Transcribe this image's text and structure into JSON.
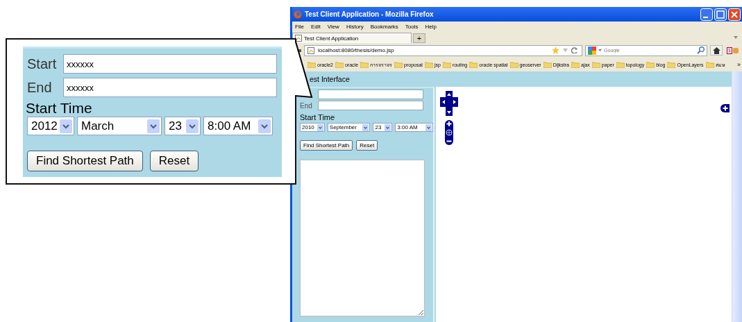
{
  "window": {
    "title": "Test Client Application - Mozilla Firefox"
  },
  "menu": [
    "File",
    "Edit",
    "View",
    "History",
    "Bookmarks",
    "Tools",
    "Help"
  ],
  "tabs": [
    {
      "label": "Test Client Application",
      "selected": true
    }
  ],
  "new_tab": "+",
  "address_bar": {
    "value": "localhost:8080/thesis/demo.jsp"
  },
  "search": {
    "placeholder": "Google"
  },
  "addon_badge": "1",
  "bookmarks": [
    "oracle2",
    "oracle",
    "การจราจร",
    "proposal",
    "jsp",
    "routing",
    "oracle spatial",
    "geoserver",
    "Dijkstra",
    "ajax",
    "paper",
    "topology",
    "blog",
    "OpenLayers",
    "สมษ"
  ],
  "bookmarks_more": "»",
  "page": {
    "heading": "est Interface",
    "end_label": "End",
    "start_time_label": "Start Time",
    "selects": [
      "2010",
      "September",
      "23",
      "3:00 AM"
    ],
    "buttons": [
      "Find Shortest Path",
      "Reset"
    ]
  },
  "callout": {
    "fields": [
      {
        "label": "Start",
        "value": "xxxxxx"
      },
      {
        "label": "End",
        "value": "xxxxxx"
      }
    ],
    "start_time_label": "Start Time",
    "selects": [
      "2012",
      "March",
      "23",
      "8:00 AM"
    ],
    "buttons": [
      "Find Shortest Path",
      "Reset"
    ]
  }
}
